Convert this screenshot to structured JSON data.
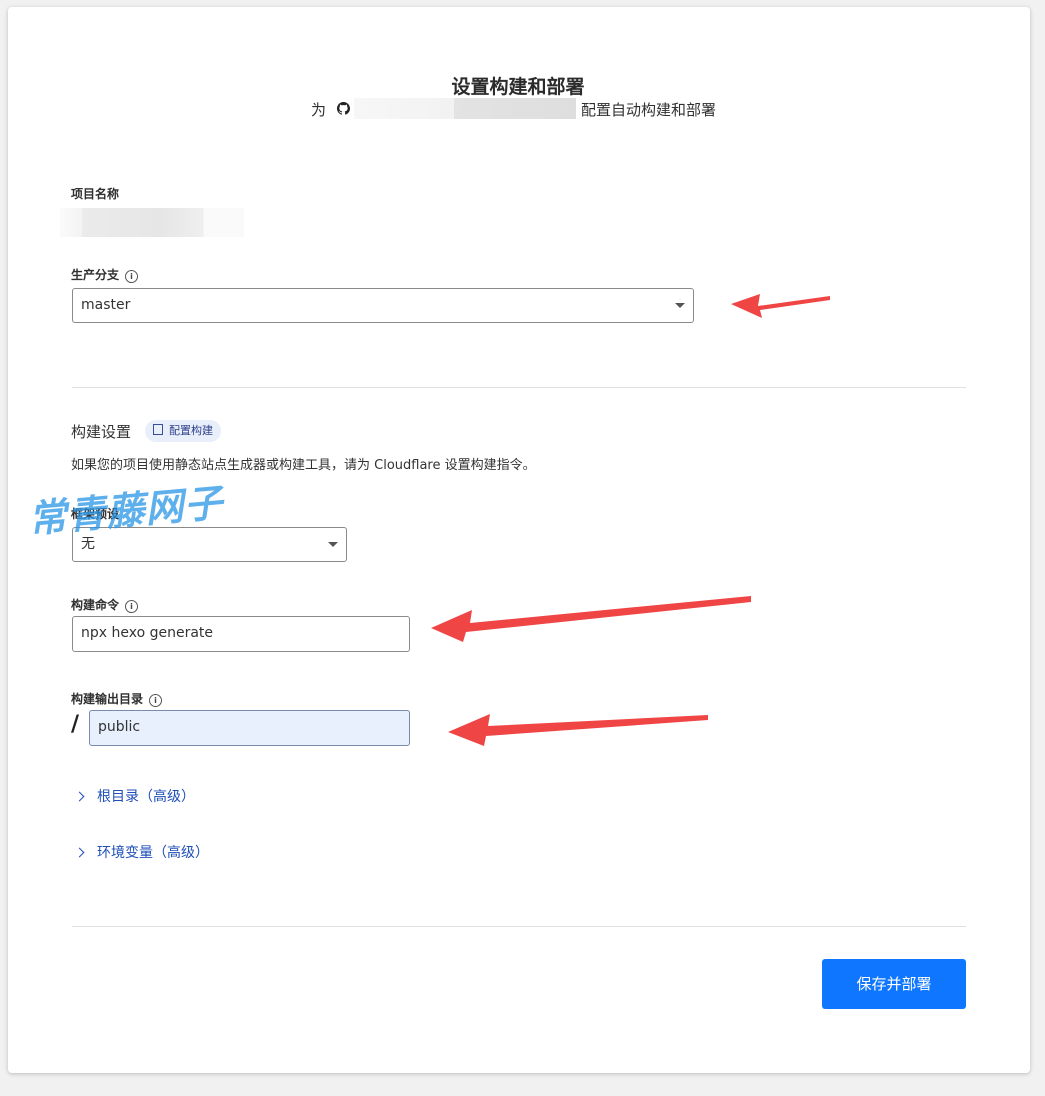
{
  "header": {
    "title": "设置构建和部署",
    "subtitle_prefix": "为",
    "subtitle_suffix": "配置自动构建和部署"
  },
  "project": {
    "name_label": "项目名称"
  },
  "branch": {
    "label": "生产分支",
    "value": "master"
  },
  "build_settings": {
    "title": "构建设置",
    "badge": "配置构建",
    "description": "如果您的项目使用静态站点生成器或构建工具，请为 Cloudflare 设置构建指令。",
    "preset_label": "框架预设",
    "preset_value": "无",
    "command_label": "构建命令",
    "command_value": "npx hexo generate",
    "output_label": "构建输出目录",
    "output_prefix": "/",
    "output_value": "public"
  },
  "advanced": {
    "root_dir": "根目录（高级）",
    "env_vars": "环境变量（高级）"
  },
  "actions": {
    "save_deploy": "保存并部署"
  },
  "watermark": "常青藤网子",
  "colors": {
    "primary": "#0f77ff",
    "link": "#1f4fb8",
    "annotation_arrow": "#f04545"
  }
}
